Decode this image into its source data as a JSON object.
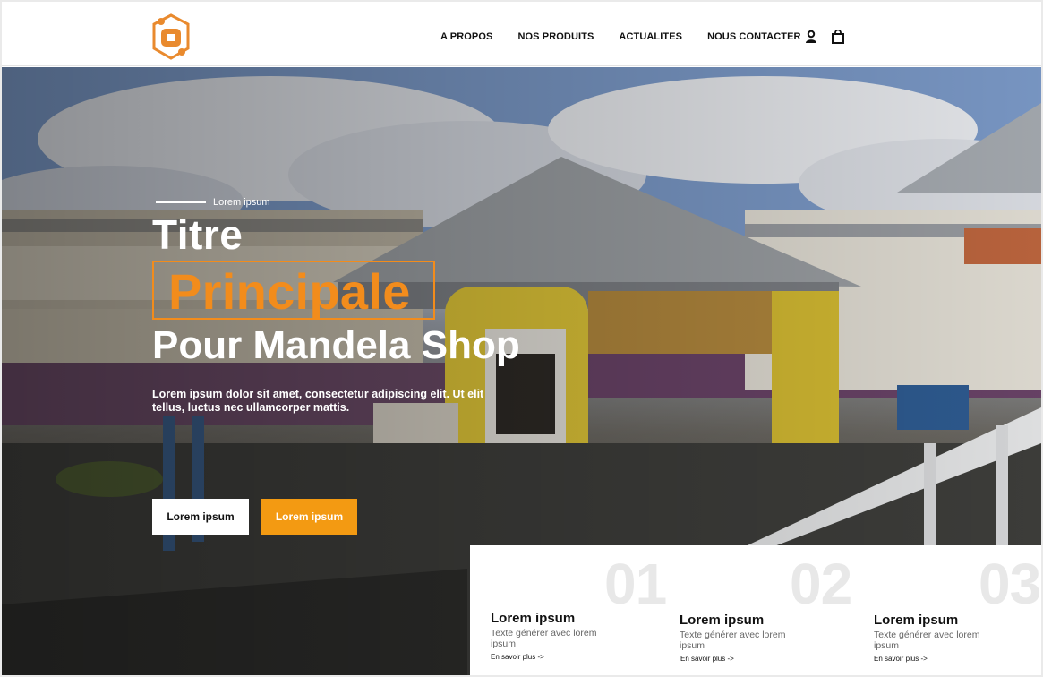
{
  "header": {
    "logo_name": "mandela-shop-logo",
    "nav": [
      "A PROPOS",
      "NOS PRODUITS",
      "ACTUALITES",
      "NOUS CONTACTER"
    ],
    "icons": [
      "user-icon",
      "shopping-bag-icon"
    ]
  },
  "hero": {
    "eyebrow": "Lorem ipsum",
    "title_line1": "Titre",
    "title_line2": "Principale",
    "title_line3": "Pour Mandela Shop",
    "description": "Lorem ipsum dolor sit amet, consectetur adipiscing elit. Ut elit tellus, luctus nec ullamcorper mattis.",
    "button_primary": "Lorem ipsum",
    "button_secondary": "Lorem ipsum"
  },
  "cards": [
    {
      "number": "01",
      "title": "Lorem ipsum",
      "text": "Texte générer avec lorem ipsum",
      "link": "En savoir plus ->"
    },
    {
      "number": "02",
      "title": "Lorem ipsum",
      "text": "Texte générer avec lorem ipsum",
      "link": "En savoir plus ->"
    },
    {
      "number": "03",
      "title": "Lorem ipsum",
      "text": "Texte générer avec lorem ipsum",
      "link": "En savoir plus ->"
    }
  ],
  "colors": {
    "accent": "#f28c1c",
    "button_orange": "#f39a12",
    "text_dark": "#111111"
  }
}
